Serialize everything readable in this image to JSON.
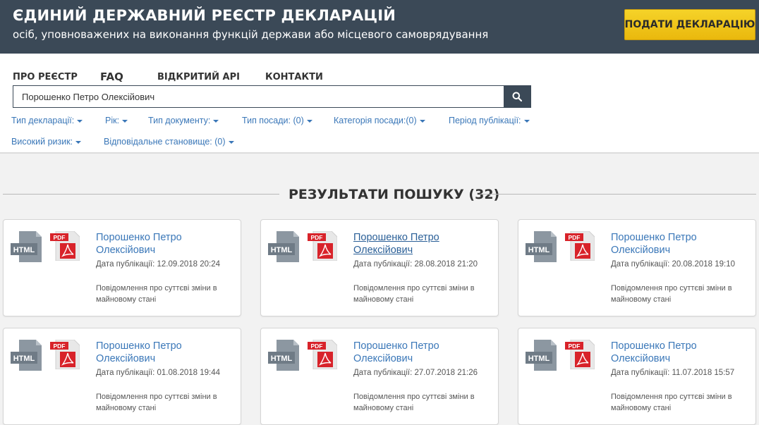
{
  "header": {
    "title": "ЄДИНИЙ ДЕРЖАВНИЙ РЕЄСТР ДЕКЛАРАЦІЙ",
    "subtitle": "осіб, уповноважених на виконання функцій держави або місцевого самоврядування",
    "submit_button": "ПОДАТИ ДЕКЛАРАЦІЮ"
  },
  "nav": [
    "ПРО РЕЄСТР",
    "FAQ",
    "ВІДКРИТИЙ API",
    "КОНТАКТИ"
  ],
  "search": {
    "value": "Порошенко Петро Олексійович"
  },
  "filters": [
    "Тип декларації:",
    "Рік:",
    "Тип документу:",
    "Тип посади: (0)",
    "Категорія посади:(0)",
    "Період публікації:",
    "Високий ризик:",
    "Відповідальне становище: (0)"
  ],
  "results": {
    "title": "РЕЗУЛЬТАТИ ПОШУКУ (32)",
    "html_label": "HTML",
    "pdf_label": "PDF",
    "cards": [
      {
        "name": "Порошенко Петро Олексійович",
        "date": "Дата публікації: 12.09.2018 20:24",
        "desc": "Повідомлення про суттєві зміни в майновому стані"
      },
      {
        "name": "Порошенко Петро Олексійович",
        "date": "Дата публікації: 28.08.2018 21:20",
        "desc": "Повідомлення про суттєві зміни в майновому стані"
      },
      {
        "name": "Порошенко Петро Олексійович",
        "date": "Дата публікації: 20.08.2018 19:10",
        "desc": "Повідомлення про суттєві зміни в майновому стані"
      },
      {
        "name": "Порошенко Петро Олексійович",
        "date": "Дата публікації: 01.08.2018 19:44",
        "desc": "Повідомлення про суттєві зміни в майновому стані"
      },
      {
        "name": "Порошенко Петро Олексійович",
        "date": "Дата публікації: 27.07.2018 21:26",
        "desc": "Повідомлення про суттєві зміни в майновому стані"
      },
      {
        "name": "Порошенко Петро Олексійович",
        "date": "Дата публікації: 11.07.2018 15:57",
        "desc": "Повідомлення про суттєві зміни в майновому стані"
      }
    ]
  },
  "colors": {
    "header_bg": "#3b4957",
    "accent_yellow": "#f0c419",
    "link_blue": "#3a77b8",
    "pdf_red": "#d8232a"
  }
}
